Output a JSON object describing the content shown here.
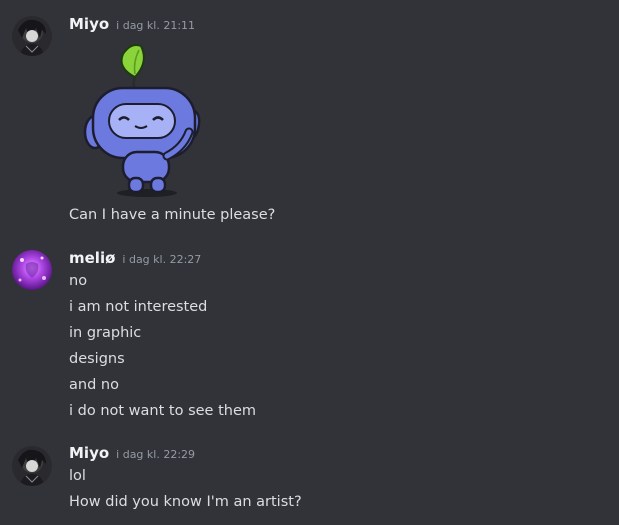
{
  "messages": [
    {
      "username": "Miyo",
      "timestamp": "i dag kl. 21:11",
      "sticker": "wumpus-leaf-sticker",
      "lines": [
        "Can I have a minute please?"
      ]
    },
    {
      "username": "meliø",
      "timestamp": "i dag kl. 22:27",
      "lines": [
        "no",
        "i am not interested",
        "in graphic",
        "designs",
        "and no",
        "i do not want to see them"
      ]
    },
    {
      "username": "Miyo",
      "timestamp": "i dag kl. 22:29",
      "lines": [
        "lol",
        "How did you know I'm an artist?"
      ]
    }
  ],
  "colors": {
    "background": "#313338",
    "username": "#f2f3f5",
    "timestamp": "#949ba4",
    "text": "#dbdee1",
    "wumpus": "#6c7ae0",
    "leaf": "#8bd33a"
  }
}
